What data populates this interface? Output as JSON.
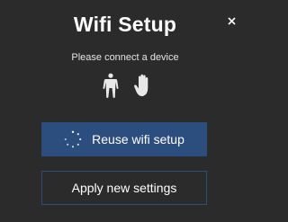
{
  "dialog": {
    "title": "Wifi Setup",
    "close_icon": "close-icon",
    "subtitle": "Please connect a device",
    "device_icons": [
      "person-silhouette-icon",
      "hand-icon"
    ],
    "primary_button": {
      "label": "Reuse wifi setup",
      "icon": "loading-spinner-icon"
    },
    "secondary_button": {
      "label": "Apply new settings"
    }
  },
  "colors": {
    "background": "#2b2b2b",
    "accent": "#2c4e7e",
    "text": "#ffffff"
  }
}
